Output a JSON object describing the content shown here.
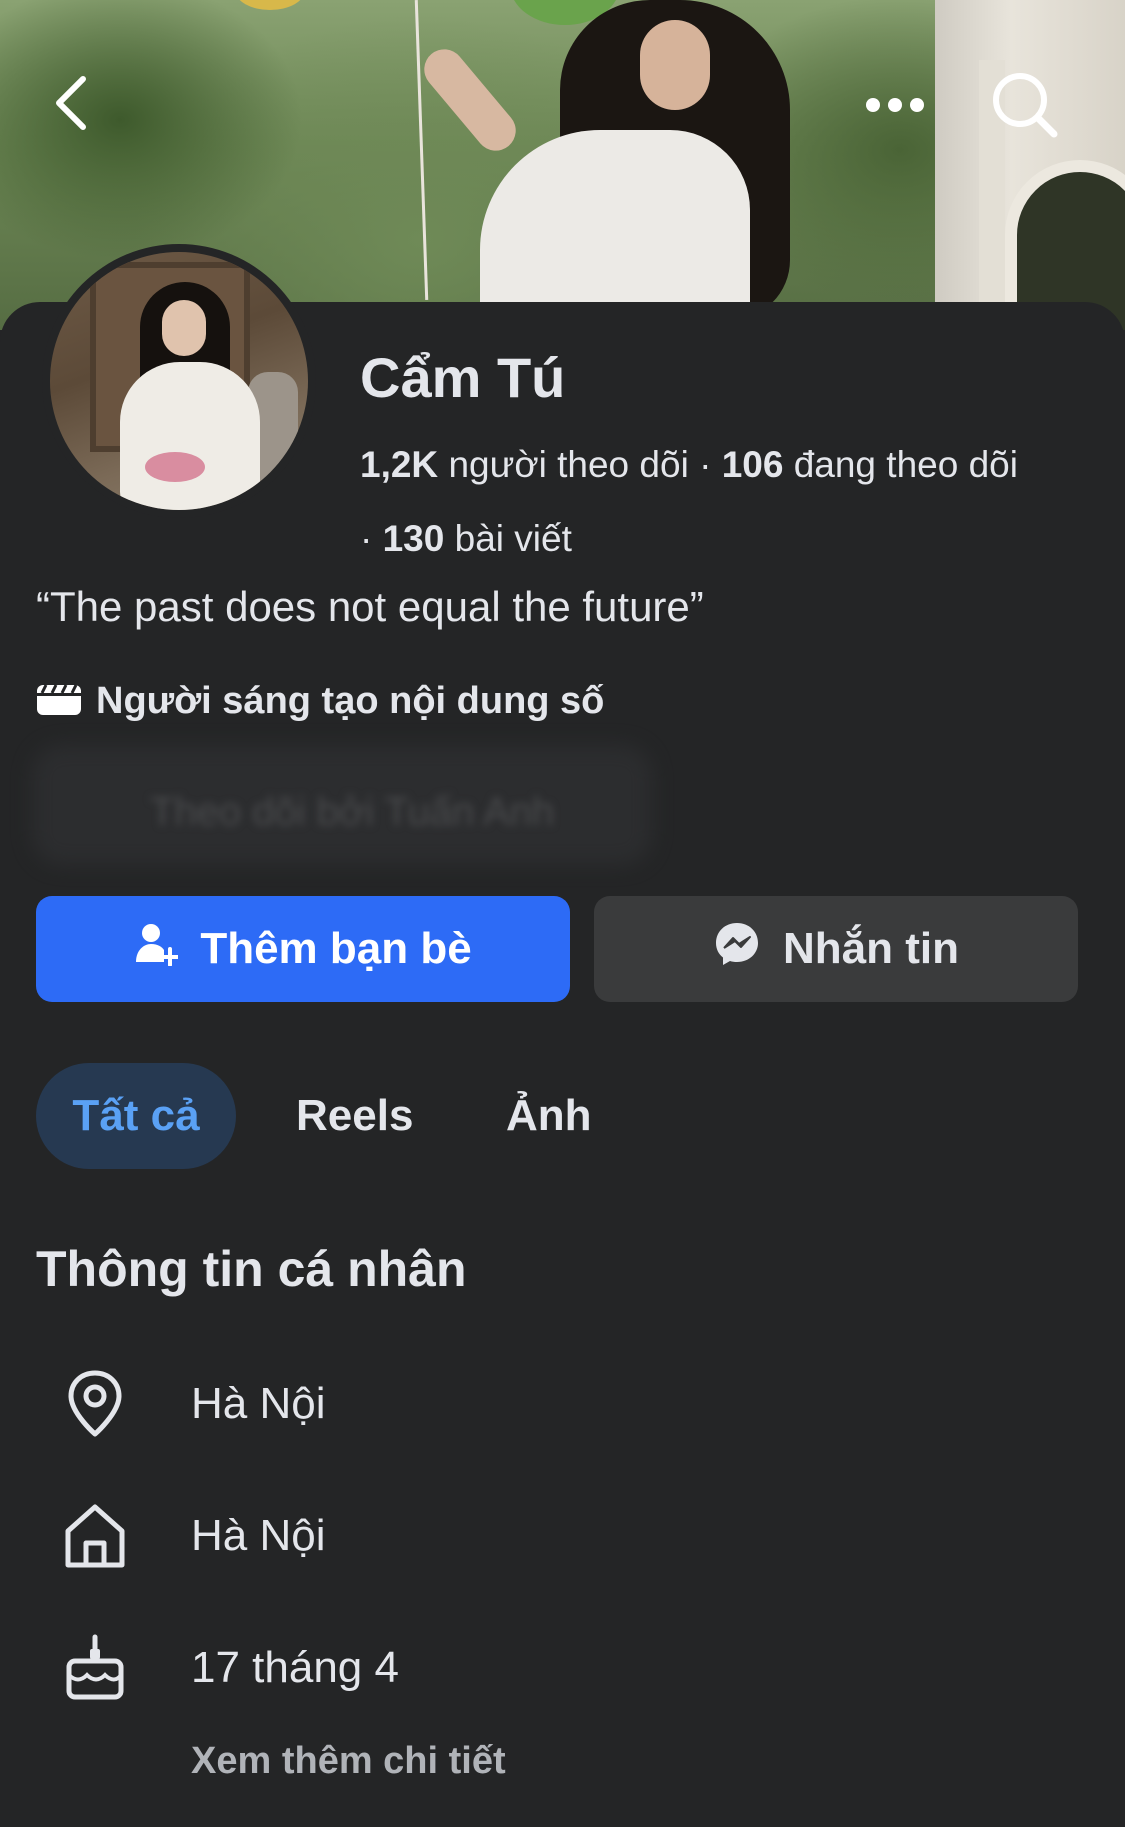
{
  "cover": {
    "icons": [
      "back-icon",
      "more-icon",
      "search-icon"
    ]
  },
  "profile": {
    "name": "Cẩm Tú",
    "followers_count": "1,2K",
    "followers_label": "người theo dõi",
    "following_count": "106",
    "following_label": "đang theo dõi",
    "posts_count": "130",
    "posts_label": "bài viết",
    "bio": "“The past does not equal the future”",
    "category": "Người sáng tạo nội dung số",
    "followed_by": "Theo dõi bởi Tuấn Anh"
  },
  "actions": {
    "add_friend": "Thêm bạn bè",
    "message": "Nhắn tin"
  },
  "tabs": [
    {
      "label": "Tất cả",
      "active": true
    },
    {
      "label": "Reels",
      "active": false
    },
    {
      "label": "Ảnh",
      "active": false
    }
  ],
  "about": {
    "title": "Thông tin cá nhân",
    "rows": [
      {
        "icon": "location-pin-icon",
        "text": "Hà Nội"
      },
      {
        "icon": "home-icon",
        "text": "Hà Nội"
      },
      {
        "icon": "birthday-cake-icon",
        "text": "17 tháng 4"
      }
    ],
    "see_more": "Xem thêm chi tiết"
  },
  "colors": {
    "background": "#242526",
    "primary_button": "#2d6bf6",
    "secondary_button": "#3a3b3c",
    "active_tab_bg": "#263951",
    "active_tab_text": "#5aa1f5",
    "text": "#e4e6eb",
    "muted_text": "#b0b3b8"
  }
}
